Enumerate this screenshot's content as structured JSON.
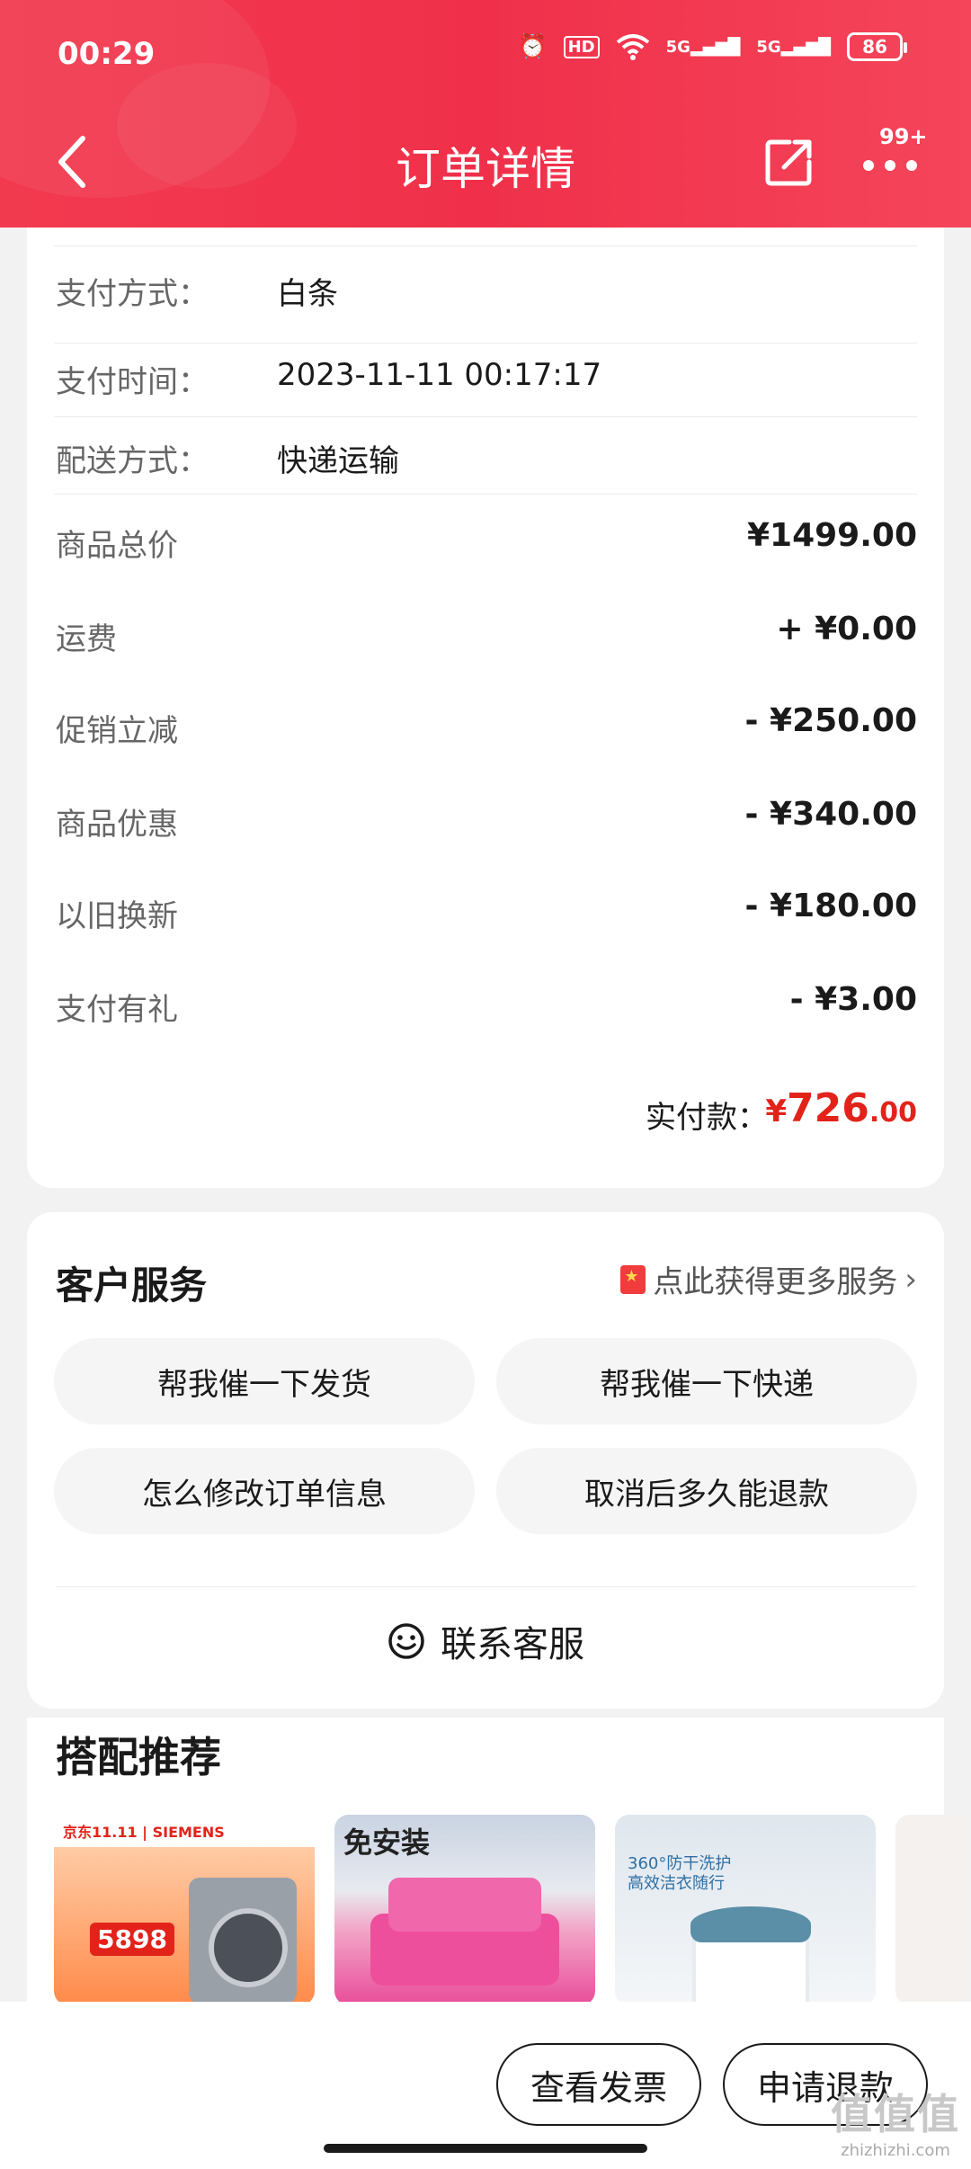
{
  "status_bar": {
    "time": "00:29",
    "battery": "86",
    "hd_label": "HD",
    "net1": "5G",
    "net2": "5G"
  },
  "nav": {
    "title": "订单详情",
    "badge": "99+"
  },
  "order_info": {
    "rows": [
      {
        "label": "支付方式：",
        "value": "白条"
      },
      {
        "label": "支付时间：",
        "value": "2023-11-11 00:17:17"
      },
      {
        "label": "配送方式：",
        "value": "快递运输"
      }
    ]
  },
  "price_rows": [
    {
      "label": "商品总价",
      "value": "¥1499.00"
    },
    {
      "label": "运费",
      "value": "+ ¥0.00"
    },
    {
      "label": "促销立减",
      "value": "- ¥250.00"
    },
    {
      "label": "商品优惠",
      "value": "- ¥340.00"
    },
    {
      "label": "以旧换新",
      "value": "- ¥180.00"
    },
    {
      "label": "支付有礼",
      "value": "- ¥3.00"
    }
  ],
  "paid": {
    "label": "实付款：",
    "currency": "¥",
    "integer": "726",
    "decimal": ".00"
  },
  "customer_service": {
    "title": "客户服务",
    "more_link": "点此获得更多服务",
    "options": [
      "帮我催一下发货",
      "帮我催一下快递",
      "怎么修改订单信息",
      "取消后多久能退款"
    ],
    "contact": "联系客服"
  },
  "recommend": {
    "title": "搭配推荐",
    "products": [
      {
        "tag": "京东11.11 | SIEMENS",
        "price": "5898"
      },
      {
        "tag": "免安装"
      },
      {
        "tag": "360°防干洗护 高效洁衣随行"
      },
      {
        "tag": ""
      }
    ]
  },
  "bottom_actions": {
    "invoice": "查看发票",
    "refund": "申请退款"
  },
  "watermark": {
    "logo": "值值值",
    "url": "zhizhizhi.com"
  },
  "colors": {
    "header": "#f0304a",
    "accent": "#e2231a"
  }
}
